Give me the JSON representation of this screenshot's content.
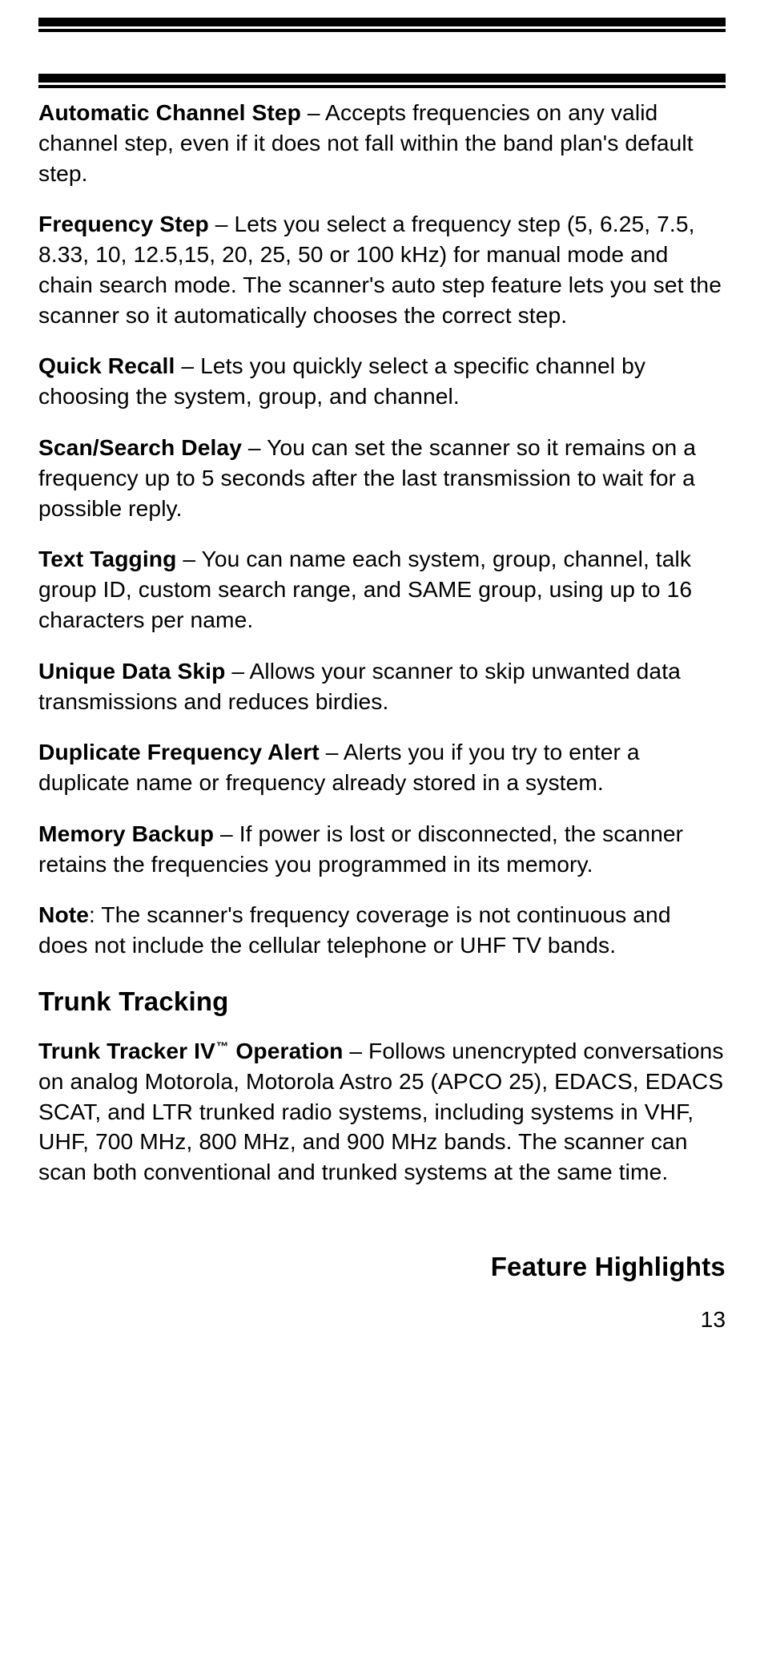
{
  "features": [
    {
      "term": "Automatic Channel Step",
      "sep": " – ",
      "desc": "Accepts frequencies on any valid channel step, even if it does not fall within the band plan's default step."
    },
    {
      "term": "Frequency Step",
      "sep": " – ",
      "desc": "Lets you select a frequency step (5, 6.25, 7.5, 8.33, 10, 12.5,15, 20, 25, 50 or 100 kHz) for manual mode and chain search mode. The scanner's auto step feature lets you set the scanner so it automatically chooses the correct step."
    },
    {
      "term": "Quick Recall",
      "sep": " – ",
      "desc": "Lets you quickly select a specific channel by choosing the system, group, and channel."
    },
    {
      "term": "Scan/Search Delay",
      "sep": " – ",
      "desc": "You can set the scanner so it remains on a frequency up to 5 seconds after the last transmission to wait for a possible reply."
    },
    {
      "term": "Text Tagging",
      "sep": " – ",
      "desc": "You can name each system, group, channel, talk group ID, custom search range, and SAME group, using up to 16 characters per name."
    },
    {
      "term": "Unique Data Skip",
      "sep": " – ",
      "desc": "Allows your scanner to skip unwanted data transmissions and reduces birdies."
    },
    {
      "term": "Duplicate Frequency Alert",
      "sep": " – ",
      "desc": "Alerts you if you try to enter a duplicate name or frequency already stored in a system."
    },
    {
      "term": "Memory Backup",
      "sep": " – ",
      "desc": "If power is lost or disconnected, the scanner retains the frequencies you programmed in its memory."
    }
  ],
  "note": {
    "label": "Note",
    "sep": ": ",
    "text": "The scanner's frequency coverage is not continuous and does not include the cellular telephone or UHF TV bands."
  },
  "trunk": {
    "heading": "Trunk Tracking",
    "term_prefix": "Trunk Tracker IV",
    "tm": "™",
    "term_suffix": " Operation",
    "sep": " – ",
    "desc": "Follows unencrypted conversations on analog Motorola, Motorola Astro 25 (APCO 25), EDACS, EDACS SCAT, and LTR trunked radio systems, including systems in VHF, UHF, 700 MHz, 800 MHz, and 900 MHz bands. The scanner can scan both conventional and trunked systems at the same time."
  },
  "footer": {
    "title": "Feature Highlights",
    "page_number": "13"
  }
}
